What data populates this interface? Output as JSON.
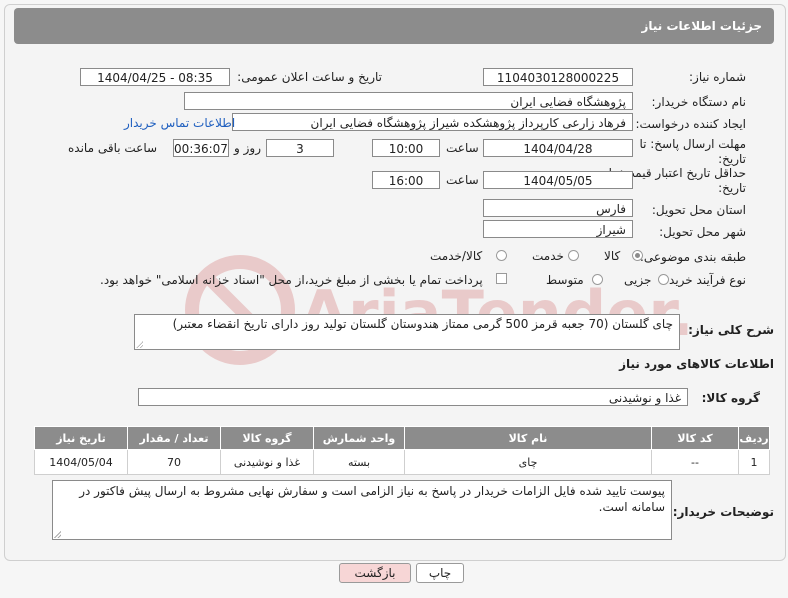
{
  "header": {
    "title": "جزئیات اطلاعات نیاز"
  },
  "fields": {
    "need_number_label": "شماره نیاز:",
    "need_number": "1104030128000225",
    "announce_label": "تاریخ و ساعت اعلان عمومی:",
    "announce_value": "1404/04/25 - 08:35",
    "buyer_org_label": "نام دستگاه خریدار:",
    "buyer_org": "پژوهشگاه فضایی ایران",
    "creator_label": "ایجاد کننده درخواست:",
    "creator": "فرهاد زارعی کارپرداز پژوهشکده شیراز پژوهشگاه فضایی ایران",
    "contact_link": "اطلاعات تماس خریدار",
    "deadline_label": "مهلت ارسال پاسخ: تا تاریخ:",
    "deadline_date": "1404/04/28",
    "time_label": "ساعت",
    "deadline_time": "10:00",
    "days_value": "3",
    "days_label": "روز و",
    "remaining_time": "00:36:07",
    "remaining_label": "ساعت باقی مانده",
    "price_validity_label": "حداقل تاریخ اعتبار قیمت: تا تاریخ:",
    "price_validity_date": "1404/05/05",
    "price_time_label": "ساعت",
    "price_validity_time": "16:00",
    "province_label": "استان محل تحویل:",
    "province": "فارس",
    "city_label": "شهر محل تحویل:",
    "city": "شیراز",
    "category_label": "طبقه بندی موضوعی:",
    "category_options": [
      "کالا",
      "خدمت",
      "کالا/خدمت"
    ],
    "process_label": "نوع فرآیند خرید :",
    "process_options": [
      "جزیی",
      "متوسط"
    ],
    "payment_note": "پرداخت تمام یا بخشی از مبلغ خرید،از محل \"اسناد خزانه اسلامی\" خواهد بود."
  },
  "description": {
    "label": "شرح کلی نیاز:",
    "text": "چای گلستان (70 جعبه قرمز 500 گرمی ممتاز هندوستان گلستان تولید روز دارای تاریخ انقضاء معتبر)"
  },
  "goods_section": {
    "title": "اطلاعات کالاهای مورد نیاز",
    "group_label": "گروه کالا:",
    "group_value": "غذا و نوشیدنی"
  },
  "goods_table": {
    "headers": [
      "ردیف",
      "کد کالا",
      "نام کالا",
      "واحد شمارش",
      "گروه کالا",
      "تعداد / مقدار",
      "تاریخ نیاز"
    ],
    "rows": [
      [
        "1",
        "--",
        "چای",
        "بسته",
        "غذا و نوشیدنی",
        "70",
        "1404/05/04"
      ]
    ]
  },
  "buyer_notes": {
    "label": "توضیحات خریدار:",
    "text": "پیوست تایید شده فایل الزامات خریدار در پاسخ به نیاز الزامی است و سفارش نهایی مشروط به ارسال پیش فاکتور در سامانه است."
  },
  "buttons": {
    "print": "چاپ",
    "back": "بازگشت"
  },
  "watermark": {
    "text": "AriaTender.net"
  },
  "colors": {
    "header_bg": "#8c8c8c",
    "link": "#1f5fbf",
    "back_btn_bg": "#f7d6d6",
    "watermark": "#e6a0a0"
  }
}
